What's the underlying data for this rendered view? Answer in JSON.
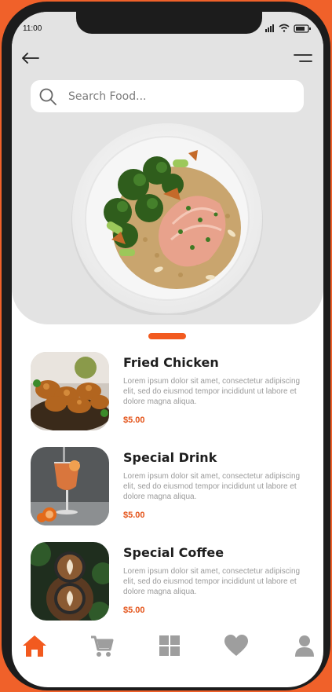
{
  "status_bar": {
    "time": "11:00"
  },
  "search": {
    "placeholder": "Search Food..."
  },
  "menu_items": [
    {
      "title": "Fried Chicken",
      "description": "Lorem ipsum dolor sit amet, consectetur adipiscing elit, sed do eiusmod tempor incididunt ut labore et dolore magna aliqua.",
      "price": "$5.00"
    },
    {
      "title": "Special Drink",
      "description": "Lorem ipsum dolor sit amet, consectetur adipiscing elit, sed do eiusmod tempor incididunt ut labore et dolore magna aliqua.",
      "price": "$5.00"
    },
    {
      "title": "Special Coffee",
      "description": "Lorem ipsum dolor sit amet, consectetur adipiscing elit, sed do eiusmod tempor incididunt ut labore et dolore magna aliqua.",
      "price": "$5.00"
    }
  ],
  "bottom_nav": {
    "items": [
      {
        "icon": "home-icon",
        "active": true
      },
      {
        "icon": "cart-icon",
        "active": false
      },
      {
        "icon": "grid-icon",
        "active": false
      },
      {
        "icon": "heart-icon",
        "active": false
      },
      {
        "icon": "profile-icon",
        "active": false
      }
    ]
  },
  "colors": {
    "accent": "#f25a1f",
    "price": "#e4541a",
    "hero_background": "#e3e3e3",
    "nav_inactive": "#9e9e9e"
  }
}
